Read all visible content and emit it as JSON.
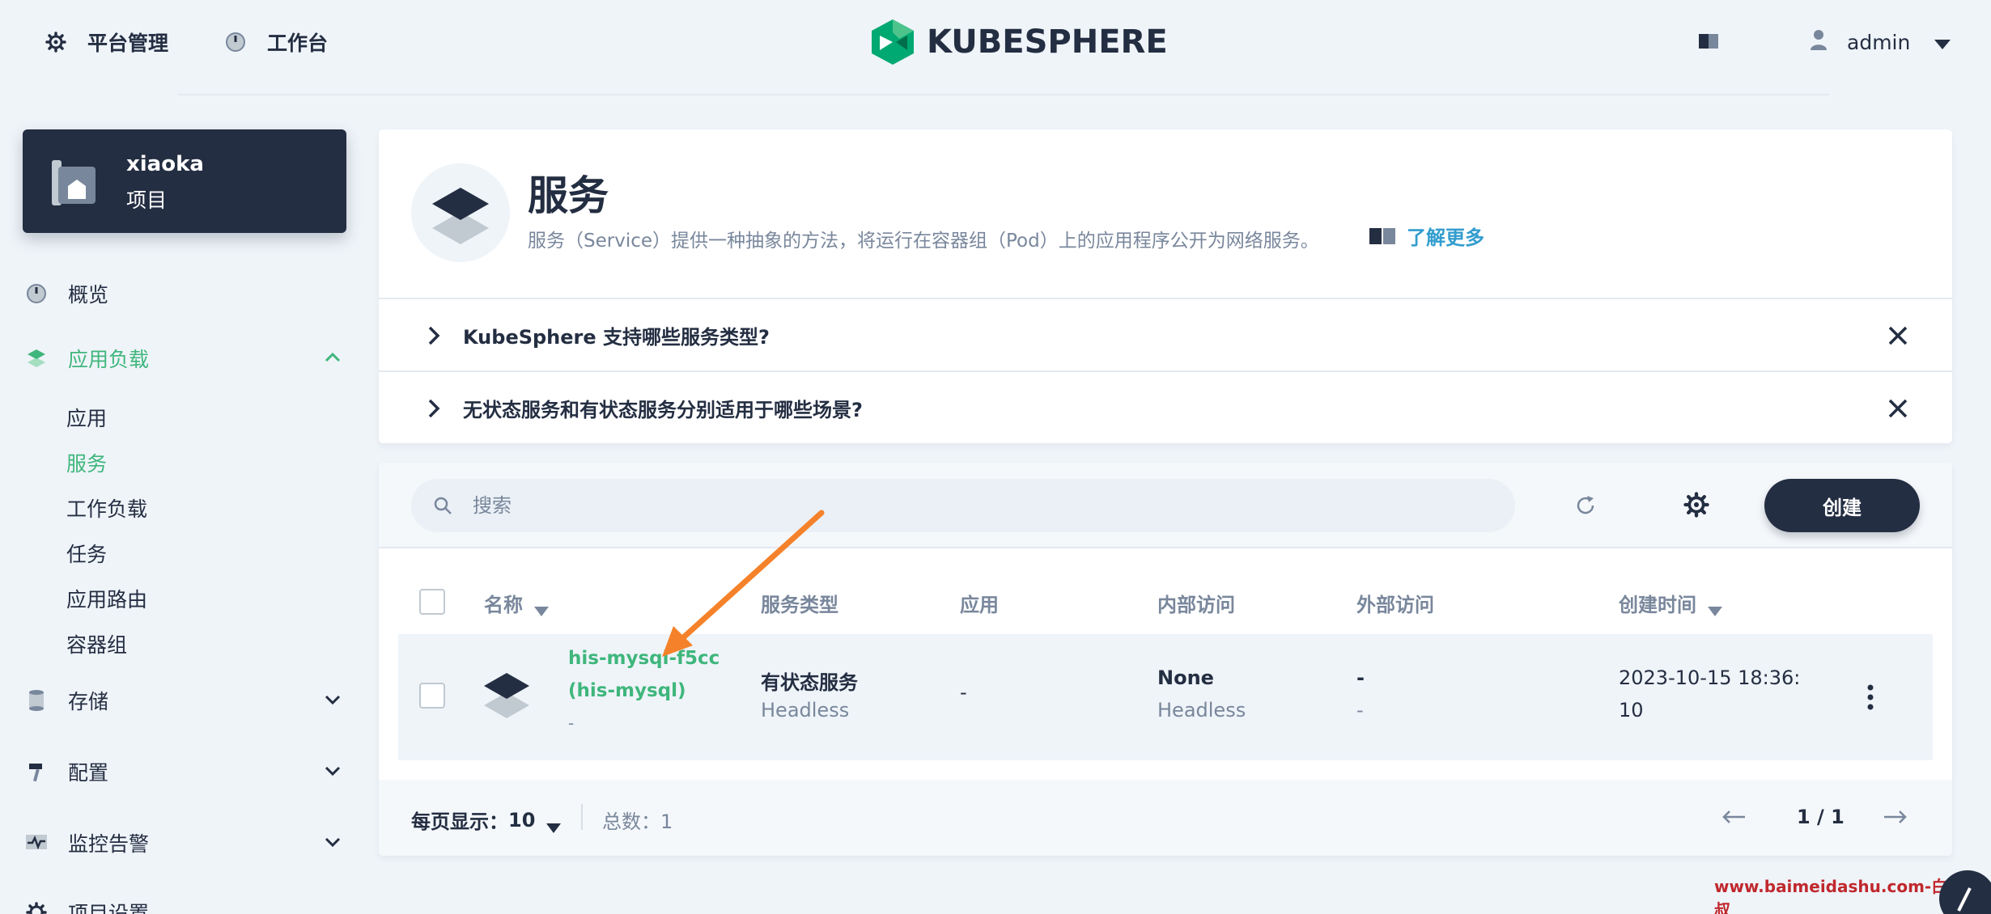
{
  "topbar": {
    "platform_label": "平台管理",
    "workbench_label": "工作台",
    "logo_text": "KUBESPHERE",
    "user_name": "admin"
  },
  "project": {
    "name": "xiaoka",
    "type": "项目"
  },
  "sidebar": {
    "overview": "概览",
    "workloads": "应用负载",
    "sub_items": [
      "应用",
      "服务",
      "工作负载",
      "任务",
      "应用路由",
      "容器组"
    ],
    "active_sub": "服务",
    "storage": "存储",
    "config": "配置",
    "monitoring": "监控告警",
    "project_settings": "项目设置"
  },
  "header": {
    "title": "服务",
    "description": "服务（Service）提供一种抽象的方法，将运行在容器组（Pod）上的应用程序公开为网络服务。",
    "learn_more": "了解更多",
    "faq": [
      "KubeSphere 支持哪些服务类型?",
      "无状态服务和有状态服务分别适用于哪些场景?"
    ]
  },
  "toolbar": {
    "search_placeholder": "搜索",
    "create_label": "创建"
  },
  "table": {
    "columns": [
      "名称",
      "服务类型",
      "应用",
      "内部访问",
      "外部访问",
      "创建时间"
    ],
    "rows": [
      {
        "name_line1": "his-mysql-f5cc",
        "name_line2": "(his-mysql)",
        "name_sub": "-",
        "service_type": "有状态服务",
        "service_type_sub": "Headless",
        "app": "-",
        "internal": "None",
        "internal_sub": "Headless",
        "external": "-",
        "external_sub": "-",
        "created_line1": "2023-10-15 18:36:",
        "created_line2": "10"
      }
    ]
  },
  "footer": {
    "per_page_label": "每页显示：",
    "per_page_value": "10",
    "total": "总数：1",
    "page": "1 / 1"
  },
  "watermark": "www.baimeidashu.com-白眉大叔",
  "colors": {
    "accent_green": "#3fb67c",
    "dark": "#242e42",
    "link_blue": "#329dce",
    "annotation_orange": "#f5822a"
  }
}
